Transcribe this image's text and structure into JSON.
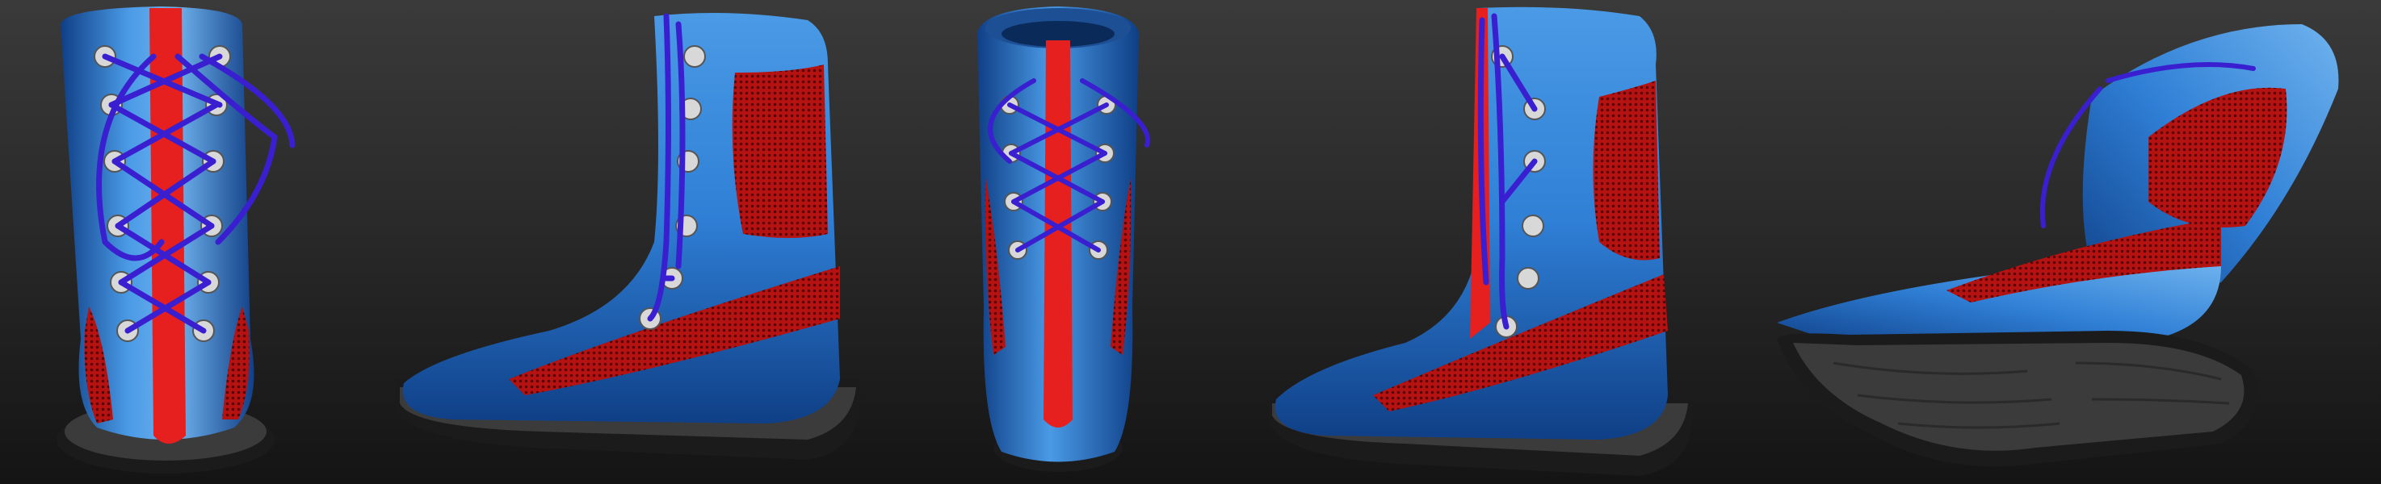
{
  "scene": {
    "background_top": "#3a3a3a",
    "background_bottom": "#141414",
    "subject": "boot",
    "views": [
      {
        "id": "front"
      },
      {
        "id": "side-left"
      },
      {
        "id": "front-top"
      },
      {
        "id": "side-right"
      },
      {
        "id": "sole-tilted"
      }
    ]
  },
  "colors": {
    "leather": "#2f7fd6",
    "leather_highlight": "#6fb3ee",
    "leather_shadow": "#0f3f86",
    "mesh": "#c11414",
    "mesh_dark": "#6a0606",
    "tongue": "#e61f1f",
    "lace": "#3a1fd0",
    "eyelet": "#d8d8d8",
    "sole": "#3b3b3b",
    "sole_edge": "#1b1b1b"
  }
}
